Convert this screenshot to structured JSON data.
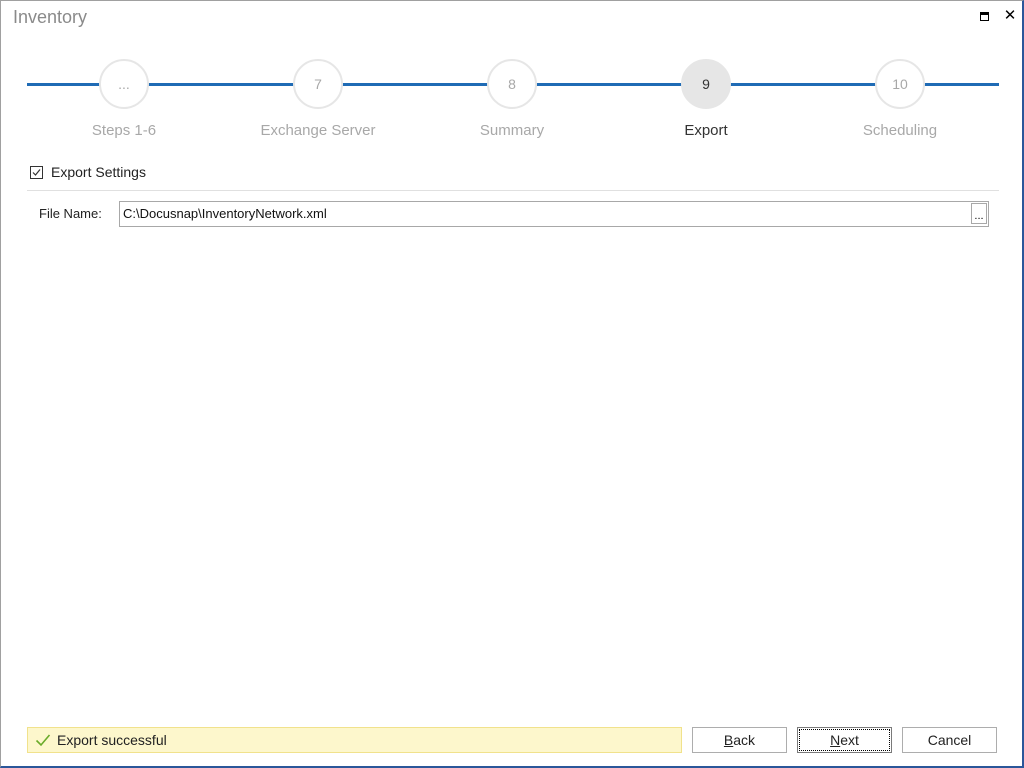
{
  "window": {
    "title": "Inventory",
    "controls": {
      "maximize": "maximize-icon",
      "close": "close-icon"
    }
  },
  "stepper": {
    "accent_color": "#1f6bb5",
    "steps": [
      {
        "number": "...",
        "label": "Steps 1-6",
        "active": false
      },
      {
        "number": "7",
        "label": "Exchange Server",
        "active": false
      },
      {
        "number": "8",
        "label": "Summary",
        "active": false
      },
      {
        "number": "9",
        "label": "Export",
        "active": true
      },
      {
        "number": "10",
        "label": "Scheduling",
        "active": false
      }
    ]
  },
  "export_settings": {
    "label": "Export Settings",
    "checked": true,
    "file_name_label": "File Name:",
    "file_name_value": "C:\\Docusnap\\InventoryNetwork.xml",
    "browse_label": "..."
  },
  "status": {
    "icon": "checkmark-icon",
    "text": "Export successful",
    "background": "#fdf7cc"
  },
  "buttons": {
    "back": {
      "mnemonic": "B",
      "rest": "ack"
    },
    "next": {
      "mnemonic": "N",
      "rest": "ext"
    },
    "cancel": "Cancel"
  }
}
